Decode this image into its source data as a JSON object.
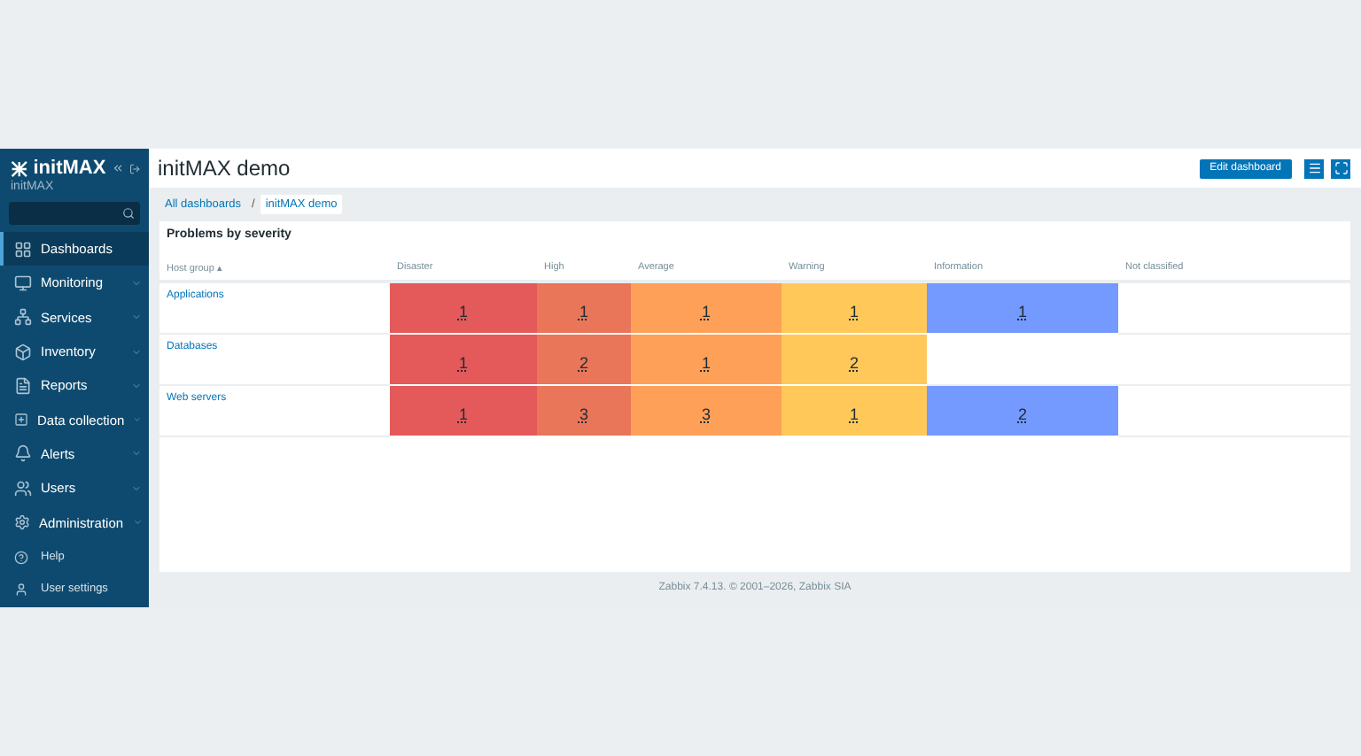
{
  "sidebar": {
    "logo": "initMAX",
    "server_name": "initMAX",
    "items": [
      {
        "label": "Dashboards",
        "selected": true,
        "expandable": false
      },
      {
        "label": "Monitoring",
        "selected": false,
        "expandable": true
      },
      {
        "label": "Services",
        "selected": false,
        "expandable": true
      },
      {
        "label": "Inventory",
        "selected": false,
        "expandable": true
      },
      {
        "label": "Reports",
        "selected": false,
        "expandable": true
      },
      {
        "label": "Data collection",
        "selected": false,
        "expandable": true
      },
      {
        "label": "Alerts",
        "selected": false,
        "expandable": true
      },
      {
        "label": "Users",
        "selected": false,
        "expandable": true
      },
      {
        "label": "Administration",
        "selected": false,
        "expandable": true
      }
    ],
    "bottom_items": [
      {
        "label": "Help"
      },
      {
        "label": "User settings"
      }
    ]
  },
  "header": {
    "title": "initMAX demo",
    "edit_button": "Edit dashboard"
  },
  "breadcrumb_separator": "/",
  "breadcrumbs": [
    {
      "label": "All dashboards",
      "selected": false
    },
    {
      "label": "initMAX demo",
      "selected": true
    }
  ],
  "widget": {
    "title": "Problems by severity",
    "columns": [
      {
        "label": "Host group ▴"
      },
      {
        "label": "Disaster"
      },
      {
        "label": "High"
      },
      {
        "label": "Average"
      },
      {
        "label": "Warning"
      },
      {
        "label": "Information"
      },
      {
        "label": "Not classified"
      }
    ],
    "rows": [
      {
        "host_group": "Applications",
        "cells": [
          {
            "kind": "count",
            "count": "1",
            "color": "#e45959"
          },
          {
            "kind": "count",
            "count": "1",
            "color": "#e97659"
          },
          {
            "kind": "count",
            "count": "1",
            "color": "#ffa059"
          },
          {
            "kind": "count",
            "count": "1",
            "color": "#ffc859"
          },
          {
            "kind": "count",
            "count": "1",
            "color": "#7499ff"
          },
          {
            "kind": "empty"
          }
        ]
      },
      {
        "host_group": "Databases",
        "cells": [
          {
            "kind": "count",
            "count": "1",
            "color": "#e45959"
          },
          {
            "kind": "count",
            "count": "2",
            "color": "#e97659"
          },
          {
            "kind": "count",
            "count": "1",
            "color": "#ffa059"
          },
          {
            "kind": "count",
            "count": "2",
            "color": "#ffc859"
          },
          {
            "kind": "empty"
          },
          {
            "kind": "empty"
          }
        ]
      },
      {
        "host_group": "Web servers",
        "cells": [
          {
            "kind": "count",
            "count": "1",
            "color": "#e45959"
          },
          {
            "kind": "count",
            "count": "3",
            "color": "#e97659"
          },
          {
            "kind": "count",
            "count": "3",
            "color": "#ffa059"
          },
          {
            "kind": "count",
            "count": "1",
            "color": "#ffc859"
          },
          {
            "kind": "count",
            "count": "2",
            "color": "#7499ff"
          },
          {
            "kind": "empty"
          }
        ]
      }
    ]
  },
  "footer": "Zabbix 7.4.13. © 2001–2026, Zabbix SIA"
}
